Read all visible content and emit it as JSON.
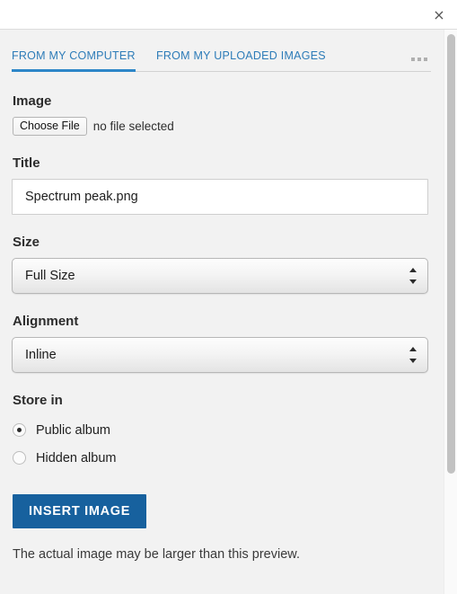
{
  "dialog": {
    "close_label": "×"
  },
  "tabs": {
    "items": [
      {
        "label": "FROM MY COMPUTER",
        "active": true
      },
      {
        "label": "FROM MY UPLOADED IMAGES",
        "active": false
      }
    ],
    "overflow_label": "more-tabs"
  },
  "form": {
    "image": {
      "label": "Image",
      "choose_file_label": "Choose File",
      "no_file_text": "no file selected"
    },
    "title": {
      "label": "Title",
      "value": "Spectrum peak.png",
      "placeholder": ""
    },
    "size": {
      "label": "Size",
      "selected": "Full Size"
    },
    "alignment": {
      "label": "Alignment",
      "selected": "Inline"
    },
    "store_in": {
      "label": "Store in",
      "options": [
        {
          "label": "Public album",
          "checked": true
        },
        {
          "label": "Hidden album",
          "checked": false
        }
      ]
    },
    "submit_label": "INSERT IMAGE",
    "note": "The actual image may be larger than this preview."
  },
  "colors": {
    "accent_blue": "#2d86c8",
    "tab_text": "#2d7cb8",
    "button_blue": "#17619e",
    "content_bg": "#f2f2f2"
  }
}
